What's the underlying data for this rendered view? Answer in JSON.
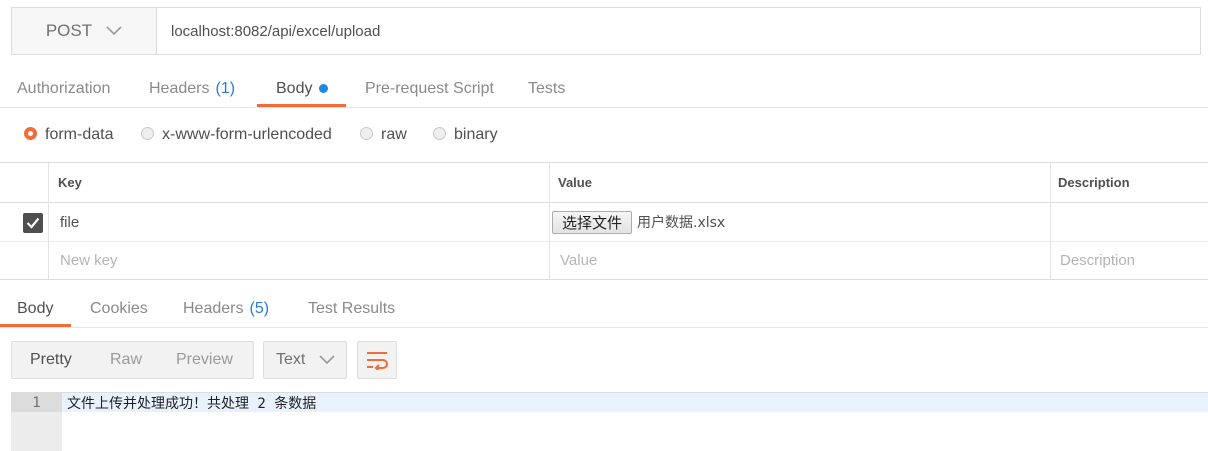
{
  "request": {
    "method": "POST",
    "url": "localhost:8082/api/excel/upload"
  },
  "request_tabs": [
    {
      "label": "Authorization",
      "count": ""
    },
    {
      "label": "Headers",
      "count": "(1)"
    },
    {
      "label": "Body",
      "count": ""
    },
    {
      "label": "Pre-request Script",
      "count": ""
    },
    {
      "label": "Tests",
      "count": ""
    }
  ],
  "body_types": [
    "form-data",
    "x-www-form-urlencoded",
    "raw",
    "binary"
  ],
  "selected_body_type": "form-data",
  "form_table": {
    "headers": {
      "key": "Key",
      "value": "Value",
      "description": "Description"
    },
    "rows": [
      {
        "checked": true,
        "key": "file",
        "file_button": "选择文件",
        "file_name": "用户数据.xlsx",
        "description": ""
      }
    ],
    "new_row": {
      "key_placeholder": "New key",
      "value_placeholder": "Value",
      "description_placeholder": "Description"
    }
  },
  "response_tabs": [
    {
      "label": "Body",
      "count": ""
    },
    {
      "label": "Cookies",
      "count": ""
    },
    {
      "label": "Headers",
      "count": "(5)"
    },
    {
      "label": "Test Results",
      "count": ""
    }
  ],
  "view_modes": [
    "Pretty",
    "Raw",
    "Preview"
  ],
  "format": "Text",
  "editor": {
    "line_number": "1",
    "content": "文件上传并处理成功！共处理 2 条数据"
  },
  "colors": {
    "accent": "#f26b3a",
    "count_blue": "#2b7ad4",
    "dot_blue": "#1e88e5"
  }
}
